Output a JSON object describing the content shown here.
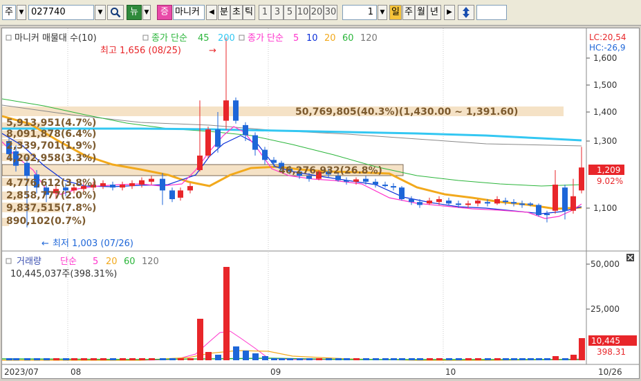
{
  "toolbar": {
    "market": "주",
    "code": "027740",
    "btn_news": "뉴",
    "btn_sym": "증",
    "name": "마니커",
    "periods": [
      "분",
      "초",
      "틱",
      "1",
      "3",
      "5",
      "10",
      "20",
      "30"
    ],
    "tick_value": "1",
    "period_day": "일",
    "period_week": "주",
    "period_month": "월",
    "period_year": "년"
  },
  "legend": {
    "title": "마니커 매물대 수(10)",
    "ma_long_label": "종가 단순",
    "ma_long": [
      "45",
      "200"
    ],
    "ma_short_label": "종가 단순",
    "ma_short": [
      "5",
      "10",
      "20",
      "60",
      "120"
    ]
  },
  "annotations": {
    "high": "최고 1,656 (08/25)",
    "low": "최저 1,003 (07/26)",
    "lc": "LC:20,54",
    "hc": "HC:-26,9",
    "current_price": "1,209",
    "current_change": "9.02%"
  },
  "volume_profile": [
    "5,913,951(4.7%)",
    "8,091,878(6.4%)",
    "2,339,701(1.9%)",
    "4,202,958(3.3%)",
    "46,276,932(26.8%)",
    "4,776,612(3.8%)",
    "2,858,777(2.0%)",
    "9,837,515(7.8%)",
    "890,102(0.7%)"
  ],
  "profile_peak_label": "50,769,805(40.3%)(1,430.00 ~ 1,391.60)",
  "volume_panel": {
    "title": "거래량",
    "ma_label": "단순",
    "ma": [
      "5",
      "20",
      "60",
      "120"
    ],
    "info": "10,445,037주(398.31%)",
    "current_value": "10,445",
    "current_pct": "398.31"
  },
  "price_axis": [
    "1,600",
    "1,500",
    "1,400",
    "1,300",
    "1,100"
  ],
  "volume_axis": [
    "50,000",
    "25,000"
  ],
  "date_axis": [
    "2023/07",
    "08",
    "09",
    "10",
    "10/26"
  ],
  "colors": {
    "up": "#e8262a",
    "down": "#1e66d8",
    "ma5": "#ff33cc",
    "ma10": "#0b2fd9",
    "ma20": "#f2a91c",
    "ma60": "#2ab53a",
    "ma120": "#888888",
    "ma_cyan": "#33c7f2",
    "profile": "#f5e2c6"
  }
}
